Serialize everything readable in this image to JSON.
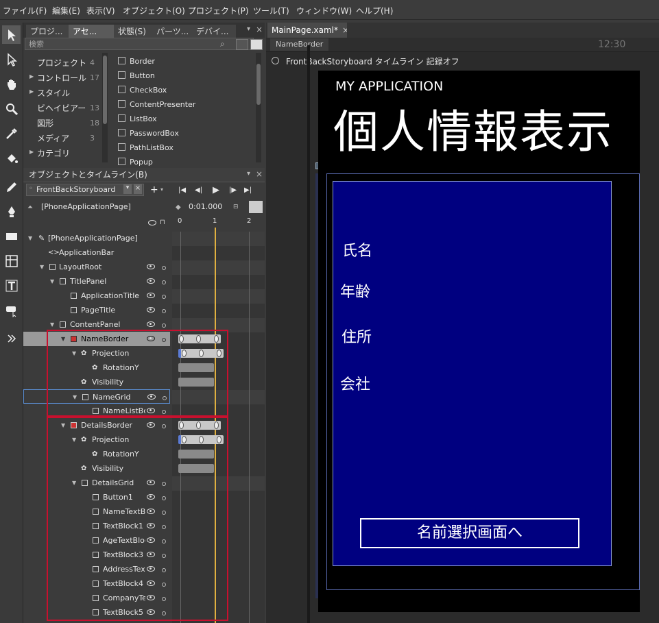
{
  "menu": [
    "ファイル(F)",
    "編集(E)",
    "表示(V)",
    "オブジェクト(O)",
    "プロジェクト(P)",
    "ツール(T)",
    "ウィンドウ(W)",
    "ヘルプ(H)"
  ],
  "assets_panel": {
    "tabs": [
      "プロジ...",
      "アセ...",
      "状態(S)",
      "パーツ...",
      "デバイ..."
    ],
    "search_placeholder": "検索",
    "categories": [
      {
        "label": "プロジェクト",
        "count": "4"
      },
      {
        "label": "コントロール",
        "count": "17"
      },
      {
        "label": "スタイル",
        "count": ""
      },
      {
        "label": "ビヘイビアー",
        "count": "13"
      },
      {
        "label": "図形",
        "count": "18"
      },
      {
        "label": "メディア",
        "count": "3"
      },
      {
        "label": "カテゴリ",
        "count": ""
      }
    ],
    "controls": [
      "Border",
      "Button",
      "CheckBox",
      "ContentPresenter",
      "ListBox",
      "PasswordBox",
      "PathListBox",
      "Popup"
    ]
  },
  "objects_panel": {
    "title": "オブジェクトとタイムライン(B)",
    "storyboard": "FrontBackStoryboard",
    "root": "[PhoneApplicationPage]",
    "time": "0:01.000",
    "ticks": [
      "0",
      "1",
      "2"
    ],
    "tree": [
      {
        "label": "[PhoneApplicationPage]",
        "indent": 0
      },
      {
        "label": "ApplicationBar",
        "indent": 1
      },
      {
        "label": "LayoutRoot",
        "indent": 1
      },
      {
        "label": "TitlePanel",
        "indent": 2
      },
      {
        "label": "ApplicationTitle",
        "indent": 3
      },
      {
        "label": "PageTitle",
        "indent": 3
      },
      {
        "label": "ContentPanel",
        "indent": 2
      },
      {
        "label": "NameBorder",
        "indent": 3
      },
      {
        "label": "Projection",
        "indent": 4
      },
      {
        "label": "RotationY",
        "indent": 5
      },
      {
        "label": "Visibility",
        "indent": 4
      },
      {
        "label": "NameGrid",
        "indent": 4
      },
      {
        "label": "NameListBc",
        "indent": 5
      },
      {
        "label": "DetailsBorder",
        "indent": 3
      },
      {
        "label": "Projection",
        "indent": 4
      },
      {
        "label": "RotationY",
        "indent": 5
      },
      {
        "label": "Visibility",
        "indent": 4
      },
      {
        "label": "DetailsGrid",
        "indent": 4
      },
      {
        "label": "Button1",
        "indent": 5
      },
      {
        "label": "NameTextBl",
        "indent": 5
      },
      {
        "label": "TextBlock1",
        "indent": 5
      },
      {
        "label": "AgeTextBloc",
        "indent": 5
      },
      {
        "label": "TextBlock3",
        "indent": 5
      },
      {
        "label": "AddressText",
        "indent": 5
      },
      {
        "label": "TextBlock4",
        "indent": 5
      },
      {
        "label": "CompanyTe",
        "indent": 5
      },
      {
        "label": "TextBlock5",
        "indent": 5
      }
    ]
  },
  "document": {
    "tab": "MainPage.xaml*",
    "breadcrumb": "NameBorder",
    "recording_status": "FrontBackStoryboard タイムライン 記録オフ",
    "clock": "12:30"
  },
  "phone": {
    "app_title": "MY APPLICATION",
    "page_title": "個人情報表示",
    "fields": [
      "氏名",
      "年齢",
      "住所",
      "会社"
    ],
    "button": "名前選択画面へ",
    "panel_color": "#000080"
  }
}
